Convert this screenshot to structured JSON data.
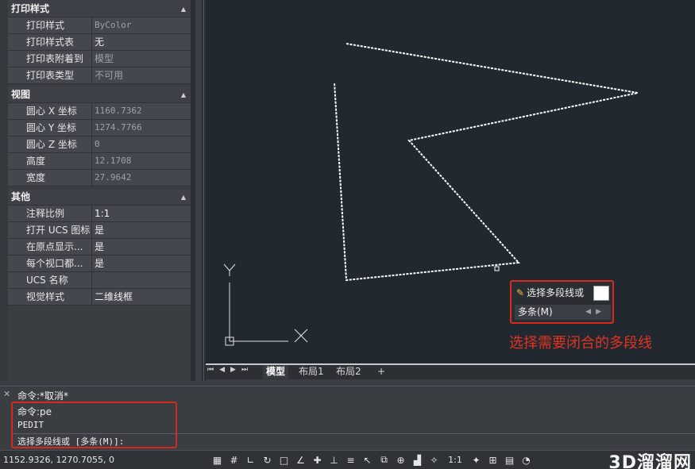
{
  "properties": {
    "sections": [
      {
        "title": "打印样式",
        "rows": [
          {
            "key": "打印样式",
            "value": "ByColor"
          },
          {
            "key": "打印样式表",
            "value": "无"
          },
          {
            "key": "打印表附着到",
            "value": "模型"
          },
          {
            "key": "打印表类型",
            "value": "不可用"
          }
        ]
      },
      {
        "title": "视图",
        "rows": [
          {
            "key": "圆心 X 坐标",
            "value": "1160.7362"
          },
          {
            "key": "圆心 Y 坐标",
            "value": "1274.7766"
          },
          {
            "key": "圆心 Z 坐标",
            "value": "0"
          },
          {
            "key": "高度",
            "value": "12.1708"
          },
          {
            "key": "宽度",
            "value": "27.9642"
          }
        ]
      },
      {
        "title": "其他",
        "rows": [
          {
            "key": "注释比例",
            "value": "1:1"
          },
          {
            "key": "打开 UCS 图标",
            "value": "是"
          },
          {
            "key": "在原点显示...",
            "value": "是"
          },
          {
            "key": "每个视口都...",
            "value": "是"
          },
          {
            "key": "UCS 名称",
            "value": ""
          },
          {
            "key": "视觉样式",
            "value": "二维线框"
          }
        ]
      }
    ]
  },
  "canvas": {
    "ucs": {
      "y_label": "Y",
      "x_label": "X"
    },
    "prompt": {
      "text": "选择多段线或",
      "option": "多条(M)"
    },
    "annotation": "选择需要闭合的多段线"
  },
  "layout_tabs": [
    "模型",
    "布局1",
    "布局2",
    "+"
  ],
  "command": {
    "history": [
      "命令:*取消*",
      "命令:pe",
      "PEDIT"
    ],
    "current": "选择多段线或 [多条(M)]:"
  },
  "status": {
    "coordinates": "1152.9326, 1270.7055, 0",
    "annotation_scale": "1:1",
    "watermark": "3D溜溜网"
  },
  "colors": {
    "canvas_bg": "#212830",
    "highlight_red": "#d62a1d",
    "annotation_red": "#e23321"
  }
}
